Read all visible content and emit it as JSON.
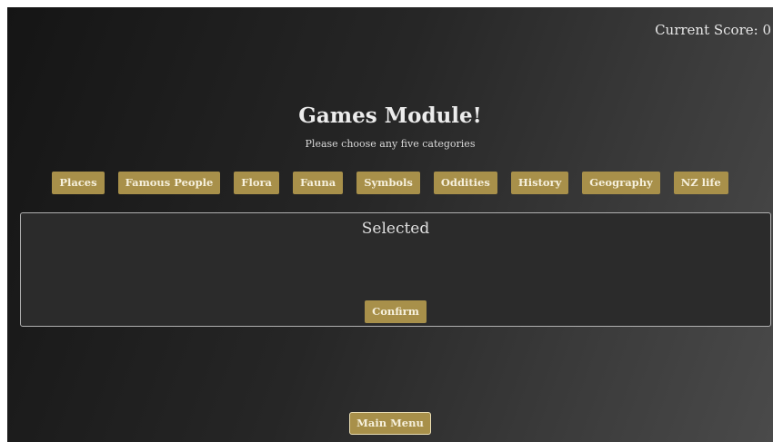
{
  "score": {
    "text": "Current Score: 0"
  },
  "header": {
    "title": "Games Module!",
    "subtitle": "Please choose any five categories"
  },
  "categories": [
    {
      "label": "Places"
    },
    {
      "label": "Famous People"
    },
    {
      "label": "Flora"
    },
    {
      "label": "Fauna"
    },
    {
      "label": "Symbols"
    },
    {
      "label": "Oddities"
    },
    {
      "label": "History"
    },
    {
      "label": "Geography"
    },
    {
      "label": "NZ life"
    }
  ],
  "selected_panel": {
    "title": "Selected",
    "confirm_label": "Confirm"
  },
  "footer": {
    "main_menu_label": "Main Menu"
  },
  "colors": {
    "button_gold": "#a8904a",
    "button_text": "#f6f0dc",
    "background_dark": "#151515",
    "background_light": "#4a4a4a"
  }
}
